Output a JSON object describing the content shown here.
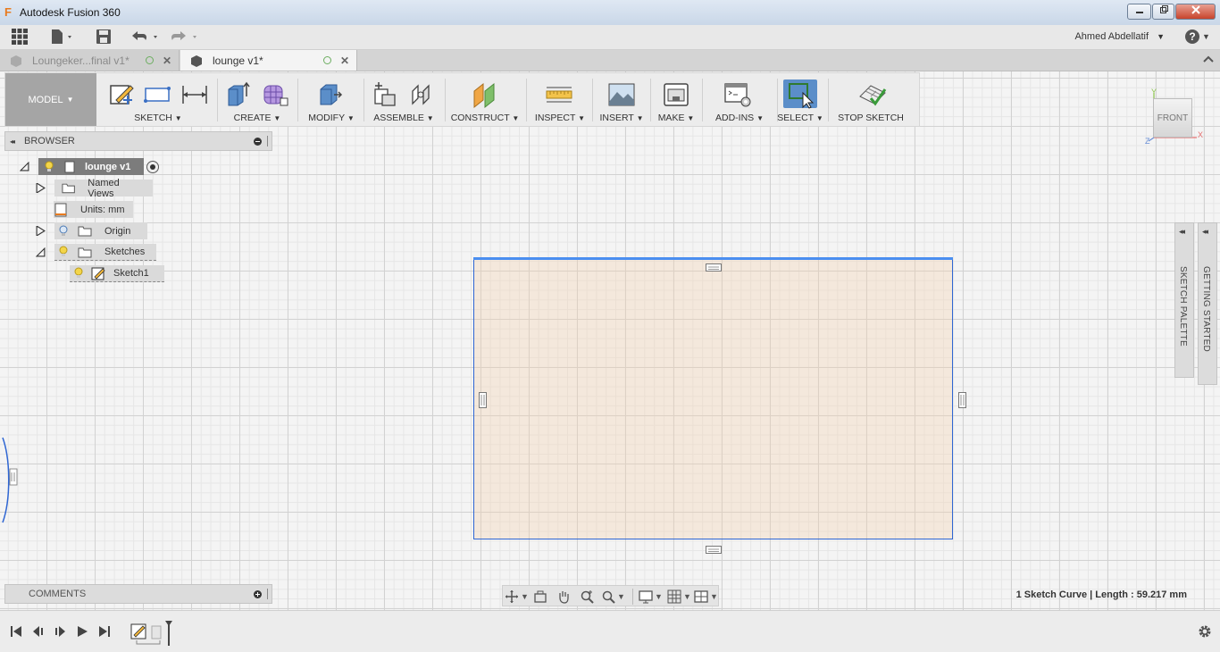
{
  "window": {
    "title": "Autodesk Fusion 360",
    "app_icon": "F"
  },
  "quick_access": {
    "user_name": "Ahmed Abdellatif",
    "user_caret": "▼",
    "help_label": "?",
    "help_caret": "▼"
  },
  "tabs": [
    {
      "label": "Loungeker...final v1*",
      "active": false
    },
    {
      "label": "lounge v1*",
      "active": true
    }
  ],
  "toolbar": {
    "workspace": "MODEL",
    "workspace_caret": "▼",
    "groups": {
      "sketch": "SKETCH",
      "create": "CREATE",
      "modify": "MODIFY",
      "assemble": "ASSEMBLE",
      "construct": "CONSTRUCT",
      "inspect": "INSPECT",
      "insert": "INSERT",
      "make": "MAKE",
      "addins": "ADD-INS",
      "select": "SELECT",
      "stop_sketch": "STOP SKETCH"
    },
    "caret": "▼"
  },
  "browser": {
    "title": "BROWSER",
    "collapse_glyph": "◂◂",
    "items": [
      {
        "label": "lounge v1"
      },
      {
        "label": "Named Views"
      },
      {
        "label": "Units: mm"
      },
      {
        "label": "Origin"
      },
      {
        "label": "Sketches"
      },
      {
        "label": "Sketch1"
      }
    ]
  },
  "viewcube": {
    "face": "FRONT",
    "axis_x": "X",
    "axis_y": "Y",
    "axis_z": "Z"
  },
  "side_panels": {
    "sketch_palette": "SKETCH PALETTE",
    "getting_started": "GETTING STARTED",
    "chevron": "◂◂"
  },
  "comments": {
    "title": "COMMENTS"
  },
  "status": {
    "text": "1 Sketch Curve | Length : 59.217 mm"
  },
  "colors": {
    "accent": "#5b8ec9",
    "sketch_line": "#2f66d3",
    "sketch_fill": "#f5d0aa"
  }
}
